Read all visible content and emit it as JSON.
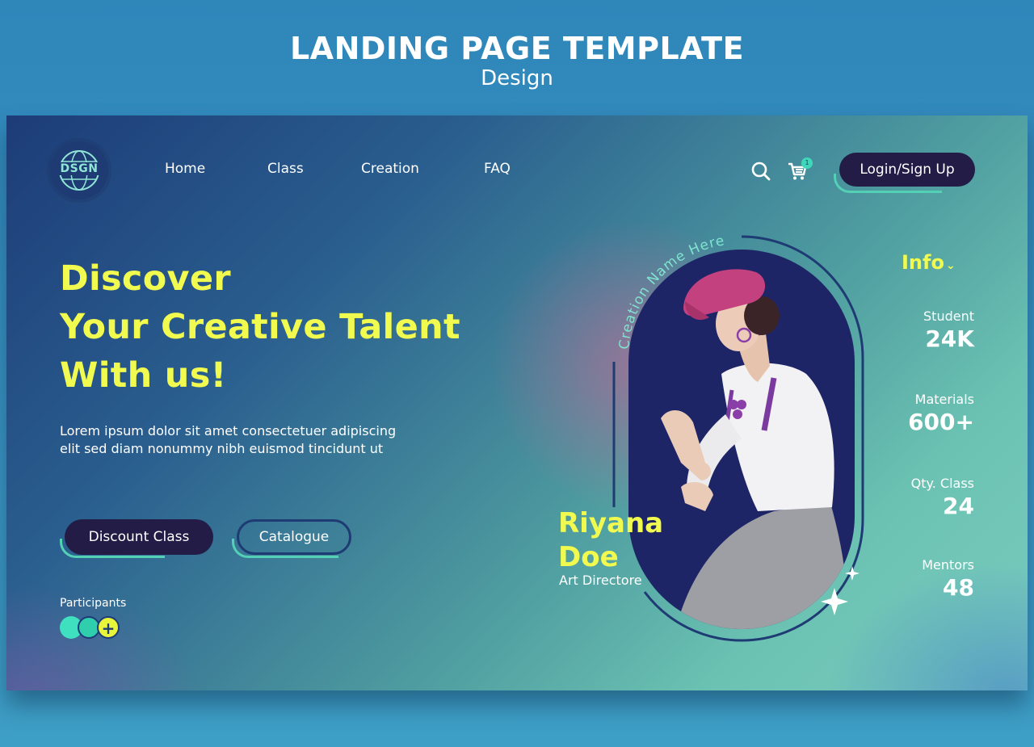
{
  "page_heading": {
    "title": "LANDING PAGE TEMPLATE",
    "subtitle": "Design"
  },
  "nav": {
    "logo_text": "DSGN",
    "links": [
      "Home",
      "Class",
      "Creation",
      "FAQ"
    ],
    "cart_count": "1",
    "login_label": "Login/Sign Up"
  },
  "hero": {
    "title_lines": [
      "Discover",
      "Your Creative Talent",
      "With us!"
    ],
    "description": "Lorem ipsum dolor sit amet consectetuer adipiscing elit sed diam nonummy nibh euismod tincidunt ut",
    "discount_label": "Discount Class",
    "catalogue_label": "Catalogue",
    "participants_label": "Participants",
    "participants_add": "+"
  },
  "feature": {
    "arc_text": "Creation Name Here",
    "first_name": "Riyana",
    "last_name": "Doe",
    "role": "Art Directore"
  },
  "info": {
    "heading": "Info",
    "stats": [
      {
        "label": "Student",
        "value": "24K"
      },
      {
        "label": "Materials",
        "value": "600+"
      },
      {
        "label": "Qty. Class",
        "value": "24"
      },
      {
        "label": "Mentors",
        "value": "48"
      }
    ]
  },
  "colors": {
    "accent_yellow": "#f1fb4f",
    "accent_teal": "#54d1b5",
    "dark_button": "#231c46",
    "navy": "#1f3b73"
  }
}
